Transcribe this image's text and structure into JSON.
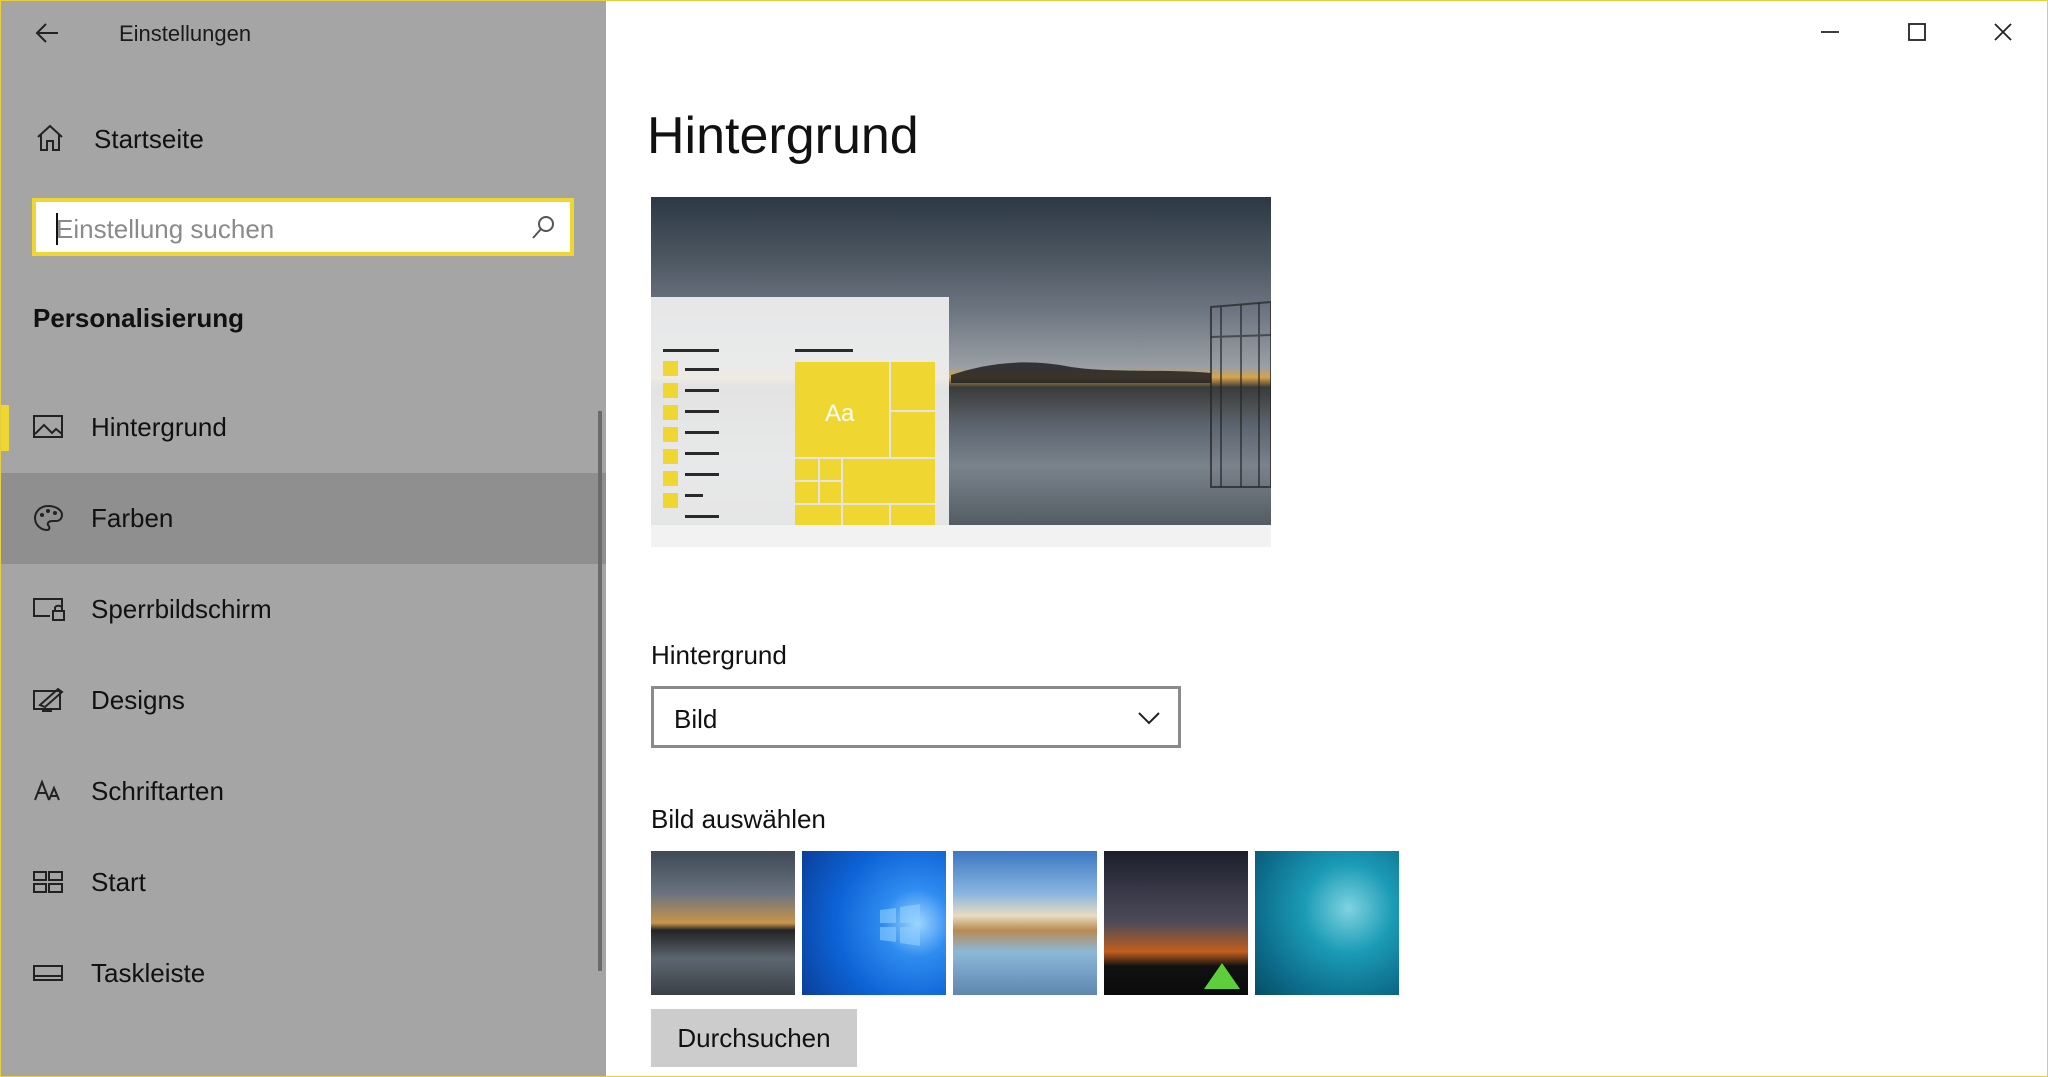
{
  "window": {
    "title": "Einstellungen",
    "controls": {
      "minimize_icon": "minimize-icon",
      "maximize_icon": "maximize-icon",
      "close_icon": "close-icon"
    },
    "accent_color": "#f0d630"
  },
  "sidebar": {
    "home_label": "Startseite",
    "search": {
      "placeholder": "Einstellung suchen",
      "value": ""
    },
    "section_title": "Personalisierung",
    "items": [
      {
        "label": "Hintergrund",
        "icon": "picture-icon",
        "selected": true
      },
      {
        "label": "Farben",
        "icon": "palette-icon",
        "hovered": true
      },
      {
        "label": "Sperrbildschirm",
        "icon": "lock-screen-icon"
      },
      {
        "label": "Designs",
        "icon": "themes-icon"
      },
      {
        "label": "Schriftarten",
        "icon": "fonts-icon"
      },
      {
        "label": "Start",
        "icon": "start-icon"
      },
      {
        "label": "Taskleiste",
        "icon": "taskbar-icon"
      }
    ]
  },
  "main": {
    "page_title": "Hintergrund",
    "preview": {
      "tile_text": "Aa"
    },
    "background_label": "Hintergrund",
    "background_select": {
      "value": "Bild"
    },
    "pick_label": "Bild auswählen",
    "browse_label": "Durchsuchen"
  }
}
